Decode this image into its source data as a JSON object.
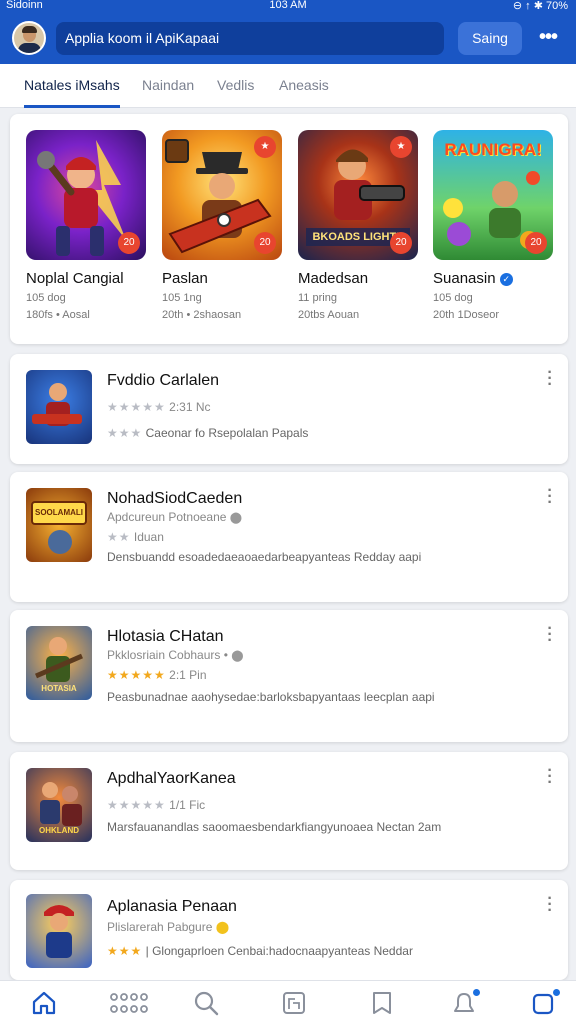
{
  "status_bar": {
    "carrier": "Sidoinn",
    "time": "103 AM",
    "indicators": "⊖ ↑ ✱ 70%"
  },
  "header": {
    "search_text": "Applia koom il ApiKapaai",
    "sign_label": "Saing",
    "more_label": "•••"
  },
  "tabs": [
    {
      "label": "Natales iMsahs",
      "active": true
    },
    {
      "label": "Naindan",
      "active": false
    },
    {
      "label": "Vedlis",
      "active": false
    },
    {
      "label": "Aneasis",
      "active": false
    }
  ],
  "featured": [
    {
      "title": "Noplal Cangial",
      "line1": "105 dog",
      "line2": "180fs • Aosal",
      "badge": "20",
      "accent": "#8a2be2"
    },
    {
      "title": "Paslan",
      "line1": "105 1ng",
      "line2": "20th • 2shaosan",
      "badge": "20",
      "accent": "#e0a020"
    },
    {
      "title": "Madedsan",
      "line1": "11 pring",
      "line2": "20tbs Aouan",
      "badge": "20",
      "banner": "BKOADS LIGHTE",
      "accent": "#1f3d8f"
    },
    {
      "title": "Suanasin",
      "line1": "105 dog",
      "line2": "20th 1Doseor",
      "badge": "20",
      "banner": "RAUNIGRA!",
      "verified": true,
      "accent": "#1da0d8"
    }
  ],
  "list": [
    {
      "title": "Fvddio Carlalen",
      "sub_stars": "★★★★★",
      "sub_text": "2:31 Nc",
      "desc_stars": "★★★",
      "desc": "Caeonar fo Rsepolalan Papals",
      "stars_gold": false
    },
    {
      "title": "NohadSiodCaeden",
      "sub_text": "Apdcureun Potnoeane",
      "desc_stars": "★★",
      "desc_extra": "Iduan",
      "desc": "Densbuandd esoadedaeaoaedarbeapyanteas Redday aapi",
      "thumb_text": "SOOLAMALI",
      "stars_gold": false
    },
    {
      "title": "Hlotasia CHatan",
      "sub_text": "Pkklosriain Cobhaurs •",
      "sub_stars": "★★★★★",
      "sub_text2": "2:1 Pin",
      "desc": "Peasbunadnae aaohysedae:barloksbapyantaas leecplan aapi",
      "thumb_text": "HOTASIA",
      "stars_gold": true
    },
    {
      "title": "ApdhalYaorKanea",
      "sub_stars": "★★★★★",
      "sub_text": "1/1 Fic",
      "desc": "Marsfauanandlas saoomaesbendarkfiangyunoaea Nectan 2am",
      "thumb_text": "OHKLAND",
      "stars_gold": false
    },
    {
      "title": "Aplanasia Penaan",
      "sub_text": "Plislarerah Pabgure",
      "desc_stars": "★★★",
      "desc": "| Glongaprloen Cenbai:hadocnaapyanteas Neddar",
      "stars_gold": true
    }
  ],
  "bottom_nav": [
    {
      "name": "home-icon",
      "active": true
    },
    {
      "name": "apps-grid-icon",
      "active": false
    },
    {
      "name": "search-icon",
      "active": false
    },
    {
      "name": "gallery-icon",
      "active": false
    },
    {
      "name": "book-icon",
      "active": false
    },
    {
      "name": "notifications-icon",
      "active": false,
      "dot": true
    },
    {
      "name": "messages-icon",
      "active": false,
      "dot": true
    }
  ],
  "colors": {
    "brand": "#1a56c4",
    "accent_star": "#f2a81d",
    "badge": "#e8452f",
    "verified": "#1a6fe0"
  }
}
